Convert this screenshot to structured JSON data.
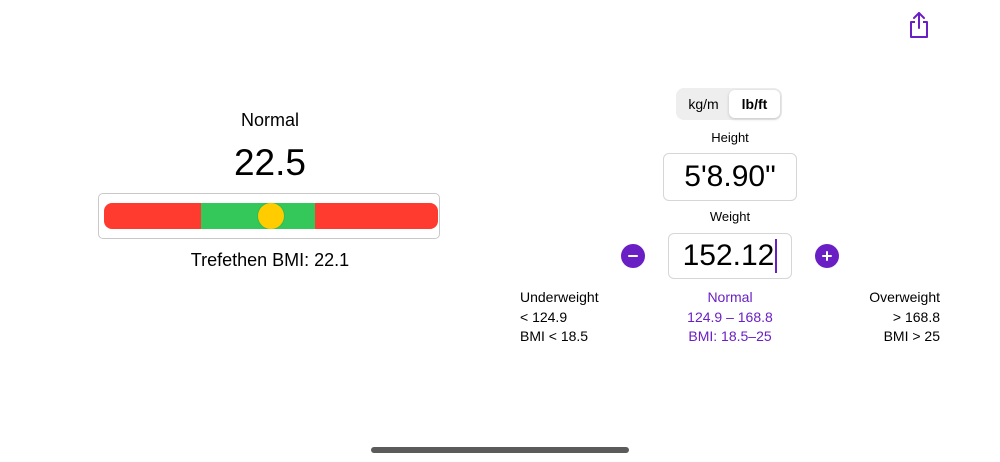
{
  "colors": {
    "accent": "#6A1FC4",
    "underweight": "#FF3B30",
    "normal": "#34C759",
    "overweight": "#FF3B30",
    "indicator": "#FFCC00"
  },
  "toolbar": {
    "share_icon": "share-icon"
  },
  "result": {
    "category": "Normal",
    "bmi": "22.5",
    "bmi_numeric": 22.5,
    "scale": {
      "min": 13.0,
      "max": 32.0,
      "normal_low": 18.5,
      "normal_high": 25
    },
    "trefethen": "Trefethen BMI: 22.1"
  },
  "units": {
    "options": [
      "kg/m",
      "lb/ft"
    ],
    "selected_index": 1
  },
  "height": {
    "caption": "Height",
    "value": "5'8.90\""
  },
  "weight": {
    "caption": "Weight",
    "value": "152.12",
    "decrement_icon": "minus-icon",
    "increment_icon": "plus-icon"
  },
  "ranges": {
    "underweight": {
      "label": "Underweight",
      "weight": "< 124.9",
      "bmi": "BMI < 18.5"
    },
    "normal": {
      "label": "Normal",
      "weight": "124.9 – 168.8",
      "bmi": "BMI: 18.5–25"
    },
    "overweight": {
      "label": "Overweight",
      "weight": "> 168.8",
      "bmi": "BMI > 25"
    }
  }
}
